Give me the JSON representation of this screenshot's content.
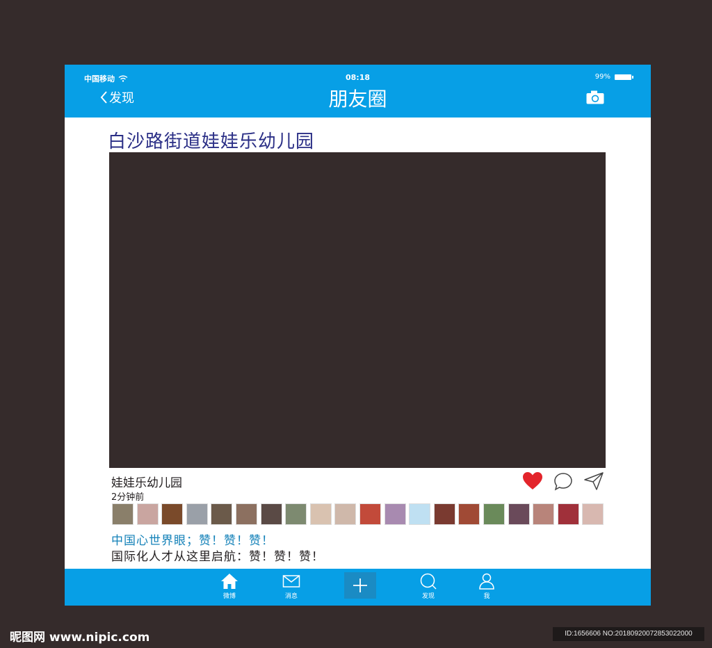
{
  "status_bar": {
    "carrier": "中国移动",
    "time": "08:18",
    "battery": "99%"
  },
  "nav": {
    "back_label": "发现",
    "title": "朋友圈"
  },
  "post": {
    "heading": "白沙路街道娃娃乐幼儿园",
    "author": "娃娃乐幼儿园",
    "time": "2分钟前",
    "comment_line1": "中国心世界眼；赞！赞！赞！",
    "comment_line2": "国际化人才从这里启航：赞！赞！赞！"
  },
  "avatars": [
    "#8a7f6a",
    "#c9a5a0",
    "#7a4a2a",
    "#9aa0a8",
    "#6b5a4a",
    "#8c7060",
    "#5a4a45",
    "#7d8a70",
    "#d9c2b0",
    "#cfb8aa",
    "#c24a3a",
    "#a88ab0",
    "#bfe0f2",
    "#7a3a30",
    "#a04a35",
    "#6a8a5a",
    "#6a4a5a",
    "#b8847a",
    "#a0303a",
    "#d8b8b0"
  ],
  "tabbar": {
    "home": "微博",
    "messages": "消息",
    "discover": "发现",
    "me": "我"
  },
  "watermark": {
    "site": "昵图网 www.nipic.com",
    "id": "ID:1656606 NO:20180920072853022000"
  },
  "colors": {
    "accent": "#079fe6",
    "heading": "#2b2f86",
    "like": "#e3242b",
    "background": "#352b2b"
  }
}
